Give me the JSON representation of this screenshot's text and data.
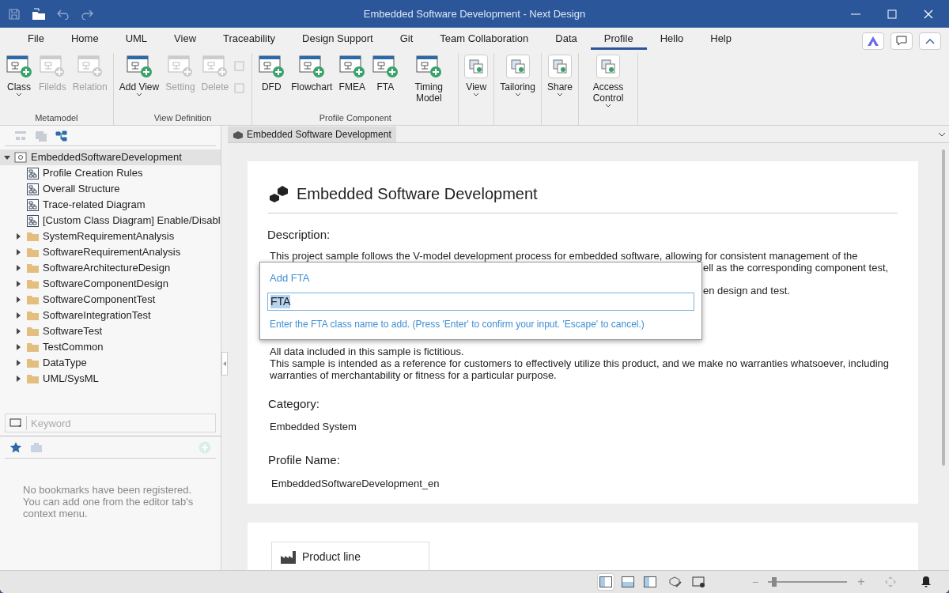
{
  "window": {
    "title": "Embedded Software Development - Next Design"
  },
  "menu_tabs": [
    {
      "label": "File",
      "selected": false
    },
    {
      "label": "Home",
      "selected": false
    },
    {
      "label": "UML",
      "selected": false
    },
    {
      "label": "View",
      "selected": false
    },
    {
      "label": "Traceability",
      "selected": false
    },
    {
      "label": "Design Support",
      "selected": false
    },
    {
      "label": "Git",
      "selected": false
    },
    {
      "label": "Team Collaboration",
      "selected": false
    },
    {
      "label": "Data",
      "selected": false
    },
    {
      "label": "Profile",
      "selected": true
    },
    {
      "label": "Hello",
      "selected": false
    },
    {
      "label": "Help",
      "selected": false
    }
  ],
  "ribbon_groups": [
    {
      "label": "Metamodel",
      "buttons": [
        {
          "kind": "large",
          "label": "Class",
          "disabled": false,
          "dropdown": true
        },
        {
          "kind": "large",
          "label": "Filelds",
          "disabled": true,
          "dropdown": false
        },
        {
          "kind": "large",
          "label": "Relation",
          "disabled": true,
          "dropdown": false
        }
      ]
    },
    {
      "label": "View Definition",
      "buttons": [
        {
          "kind": "large",
          "label": "Add View",
          "disabled": false,
          "dropdown": true
        },
        {
          "kind": "large",
          "label": "Setting",
          "disabled": true,
          "dropdown": false
        },
        {
          "kind": "large",
          "label": "Delete",
          "disabled": true,
          "dropdown": false
        },
        {
          "kind": "small",
          "disabled": true
        }
      ]
    },
    {
      "label": "Profile Component",
      "buttons": [
        {
          "kind": "large",
          "label": "DFD",
          "disabled": false,
          "dropdown": false
        },
        {
          "kind": "large",
          "label": "Flowchart",
          "disabled": false,
          "dropdown": false
        },
        {
          "kind": "large",
          "label": "FMEA",
          "disabled": false,
          "dropdown": false
        },
        {
          "kind": "large",
          "label": "FTA",
          "disabled": false,
          "dropdown": false
        },
        {
          "kind": "large",
          "label": "Timing Model",
          "disabled": false,
          "dropdown": false
        }
      ]
    },
    {
      "buttons": [
        {
          "kind": "boxed",
          "label": "View",
          "disabled": false,
          "dropdown": true
        }
      ]
    },
    {
      "buttons": [
        {
          "kind": "boxed",
          "label": "Tailoring",
          "disabled": false,
          "dropdown": true
        }
      ]
    },
    {
      "buttons": [
        {
          "kind": "boxed",
          "label": "Share",
          "disabled": false,
          "dropdown": true
        }
      ]
    },
    {
      "buttons": [
        {
          "kind": "boxed",
          "label": "Access Control",
          "disabled": false,
          "dropdown": true
        }
      ]
    }
  ],
  "tree": [
    {
      "label": "EmbeddedSoftwareDevelopment",
      "kind": "root",
      "expanded": true,
      "selected": true,
      "children": [
        {
          "label": "Profile Creation Rules",
          "kind": "diagram",
          "selected": false
        },
        {
          "label": "Overall Structure",
          "kind": "diagram",
          "selected": false
        },
        {
          "label": "Trace-related Diagram",
          "kind": "diagram",
          "selected": false
        },
        {
          "label": "[Custom Class Diagram] Enable/Disabl",
          "kind": "diagram",
          "selected": false
        },
        {
          "label": "SystemRequirementAnalysis",
          "kind": "folder",
          "expanded": false,
          "selected": false
        },
        {
          "label": "SoftwareRequirementAnalysis",
          "kind": "folder",
          "expanded": false,
          "selected": false
        },
        {
          "label": "SoftwareArchitectureDesign",
          "kind": "folder",
          "expanded": false,
          "selected": false
        },
        {
          "label": "SoftwareComponentDesign",
          "kind": "folder",
          "expanded": false,
          "selected": false
        },
        {
          "label": "SoftwareComponentTest",
          "kind": "folder",
          "expanded": false,
          "selected": false
        },
        {
          "label": "SoftwareIntegrationTest",
          "kind": "folder",
          "expanded": false,
          "selected": false
        },
        {
          "label": "SoftwareTest",
          "kind": "folder",
          "expanded": false,
          "selected": false
        },
        {
          "label": "TestCommon",
          "kind": "folder",
          "expanded": false,
          "selected": false
        },
        {
          "label": "DataType",
          "kind": "folder",
          "expanded": false,
          "selected": false
        },
        {
          "label": "UML/SysML",
          "kind": "folder",
          "expanded": false,
          "selected": false
        }
      ]
    }
  ],
  "search": {
    "placeholder": "Keyword"
  },
  "bookmarks": {
    "message": "No bookmarks have been registered. You can add one from the editor tab's context menu."
  },
  "editor_tab": {
    "label": "Embedded Software Development"
  },
  "document": {
    "title": "Embedded Software Development",
    "description_label": "Description:",
    "description_lines": [
      "This project sample follows the V-model development process for embedded software, allowing for consistent management of the",
      "ell as the corresponding component test,",
      "en design and test."
    ],
    "notice_lines": [
      "All data included in this sample is fictitious.",
      "This sample is intended as a reference for customers to effectively utilize this product, and we make no warranties whatsoever, including warranties of merchantability or fitness for a particular purpose."
    ],
    "category_label": "Category:",
    "category": "Embedded System",
    "profile_name_label": "Profile Name:",
    "profile_name": "EmbeddedSoftwareDevelopment_en",
    "section_button": "Product line"
  },
  "dialog": {
    "title": "Add FTA",
    "value": "FTA",
    "hint": "Enter the FTA class name to add. (Press 'Enter' to confirm your input. 'Escape' to cancel.)"
  },
  "status_bar": {
    "layouts": [
      {
        "selected": true
      },
      {
        "selected": false
      },
      {
        "selected": false
      }
    ],
    "zoom": {
      "level": 0.05,
      "minus": "−",
      "plus": "+"
    }
  }
}
